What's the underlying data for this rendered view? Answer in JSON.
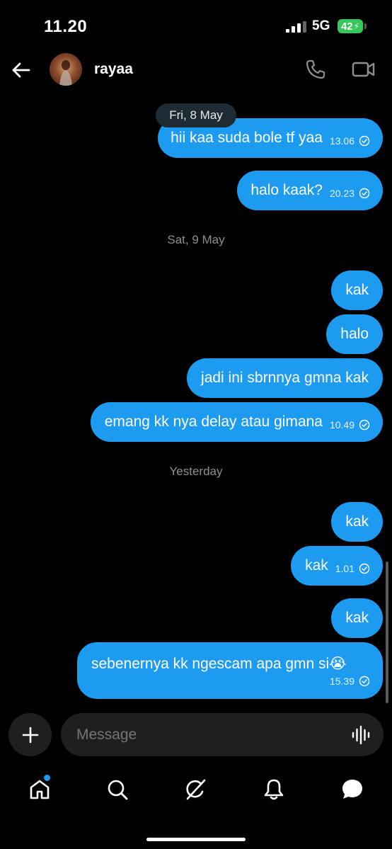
{
  "status_bar": {
    "time": "11.20",
    "network": "5G",
    "battery": "42"
  },
  "header": {
    "contact_name": "rayaa"
  },
  "dates": {
    "fri": "Fri, 8 May",
    "sat": "Sat, 9 May",
    "yesterday": "Yesterday"
  },
  "messages": [
    {
      "text": "hii kaa suda bole tf yaa",
      "time": "13.06"
    },
    {
      "text": "halo kaak?",
      "time": "20.23"
    },
    {
      "text": "kak",
      "time": ""
    },
    {
      "text": "halo",
      "time": ""
    },
    {
      "text": "jadi ini sbrnnya gmna kak",
      "time": ""
    },
    {
      "text": "emang kk nya delay atau gimana",
      "time": "10.49"
    },
    {
      "text": "kak",
      "time": ""
    },
    {
      "text": "kak",
      "time": "1.01"
    },
    {
      "text": "kak",
      "time": ""
    },
    {
      "text": "sebenernya kk ngescam apa gmn si😭",
      "time": "15.39"
    }
  ],
  "composer": {
    "placeholder": "Message"
  },
  "icons": {
    "back": "arrow-left-icon",
    "call": "phone-icon",
    "video": "video-camera-icon",
    "read": "check-circle-icon",
    "plus": "plus-icon",
    "voice": "waveform-icon",
    "home": "home-icon",
    "search": "search-icon",
    "grok": "grok-icon",
    "notifications": "bell-icon",
    "messages": "chat-bubble-icon"
  },
  "colors": {
    "bubble": "#1d9bf0",
    "background": "#000000",
    "battery": "#34c759"
  }
}
